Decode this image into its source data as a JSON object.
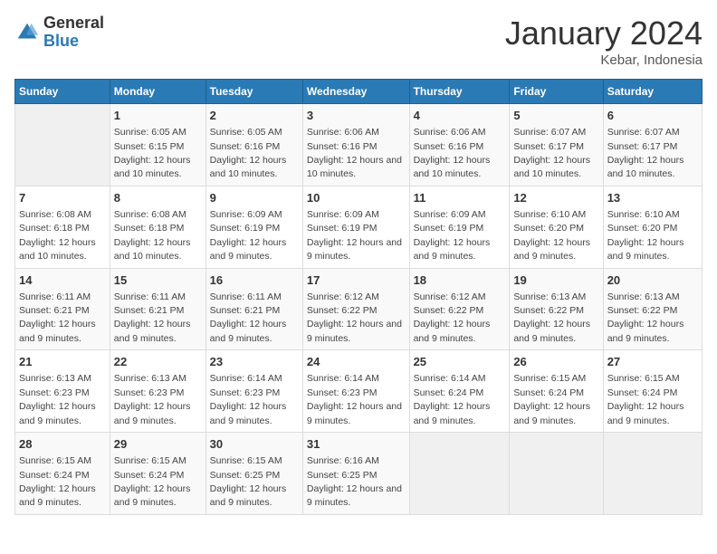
{
  "logo": {
    "general": "General",
    "blue": "Blue"
  },
  "title": "January 2024",
  "location": "Kebar, Indonesia",
  "days_header": [
    "Sunday",
    "Monday",
    "Tuesday",
    "Wednesday",
    "Thursday",
    "Friday",
    "Saturday"
  ],
  "weeks": [
    [
      {
        "num": "",
        "sunrise": "",
        "sunset": "",
        "daylight": ""
      },
      {
        "num": "1",
        "sunrise": "Sunrise: 6:05 AM",
        "sunset": "Sunset: 6:15 PM",
        "daylight": "Daylight: 12 hours and 10 minutes."
      },
      {
        "num": "2",
        "sunrise": "Sunrise: 6:05 AM",
        "sunset": "Sunset: 6:16 PM",
        "daylight": "Daylight: 12 hours and 10 minutes."
      },
      {
        "num": "3",
        "sunrise": "Sunrise: 6:06 AM",
        "sunset": "Sunset: 6:16 PM",
        "daylight": "Daylight: 12 hours and 10 minutes."
      },
      {
        "num": "4",
        "sunrise": "Sunrise: 6:06 AM",
        "sunset": "Sunset: 6:16 PM",
        "daylight": "Daylight: 12 hours and 10 minutes."
      },
      {
        "num": "5",
        "sunrise": "Sunrise: 6:07 AM",
        "sunset": "Sunset: 6:17 PM",
        "daylight": "Daylight: 12 hours and 10 minutes."
      },
      {
        "num": "6",
        "sunrise": "Sunrise: 6:07 AM",
        "sunset": "Sunset: 6:17 PM",
        "daylight": "Daylight: 12 hours and 10 minutes."
      }
    ],
    [
      {
        "num": "7",
        "sunrise": "Sunrise: 6:08 AM",
        "sunset": "Sunset: 6:18 PM",
        "daylight": "Daylight: 12 hours and 10 minutes."
      },
      {
        "num": "8",
        "sunrise": "Sunrise: 6:08 AM",
        "sunset": "Sunset: 6:18 PM",
        "daylight": "Daylight: 12 hours and 10 minutes."
      },
      {
        "num": "9",
        "sunrise": "Sunrise: 6:09 AM",
        "sunset": "Sunset: 6:19 PM",
        "daylight": "Daylight: 12 hours and 9 minutes."
      },
      {
        "num": "10",
        "sunrise": "Sunrise: 6:09 AM",
        "sunset": "Sunset: 6:19 PM",
        "daylight": "Daylight: 12 hours and 9 minutes."
      },
      {
        "num": "11",
        "sunrise": "Sunrise: 6:09 AM",
        "sunset": "Sunset: 6:19 PM",
        "daylight": "Daylight: 12 hours and 9 minutes."
      },
      {
        "num": "12",
        "sunrise": "Sunrise: 6:10 AM",
        "sunset": "Sunset: 6:20 PM",
        "daylight": "Daylight: 12 hours and 9 minutes."
      },
      {
        "num": "13",
        "sunrise": "Sunrise: 6:10 AM",
        "sunset": "Sunset: 6:20 PM",
        "daylight": "Daylight: 12 hours and 9 minutes."
      }
    ],
    [
      {
        "num": "14",
        "sunrise": "Sunrise: 6:11 AM",
        "sunset": "Sunset: 6:21 PM",
        "daylight": "Daylight: 12 hours and 9 minutes."
      },
      {
        "num": "15",
        "sunrise": "Sunrise: 6:11 AM",
        "sunset": "Sunset: 6:21 PM",
        "daylight": "Daylight: 12 hours and 9 minutes."
      },
      {
        "num": "16",
        "sunrise": "Sunrise: 6:11 AM",
        "sunset": "Sunset: 6:21 PM",
        "daylight": "Daylight: 12 hours and 9 minutes."
      },
      {
        "num": "17",
        "sunrise": "Sunrise: 6:12 AM",
        "sunset": "Sunset: 6:22 PM",
        "daylight": "Daylight: 12 hours and 9 minutes."
      },
      {
        "num": "18",
        "sunrise": "Sunrise: 6:12 AM",
        "sunset": "Sunset: 6:22 PM",
        "daylight": "Daylight: 12 hours and 9 minutes."
      },
      {
        "num": "19",
        "sunrise": "Sunrise: 6:13 AM",
        "sunset": "Sunset: 6:22 PM",
        "daylight": "Daylight: 12 hours and 9 minutes."
      },
      {
        "num": "20",
        "sunrise": "Sunrise: 6:13 AM",
        "sunset": "Sunset: 6:22 PM",
        "daylight": "Daylight: 12 hours and 9 minutes."
      }
    ],
    [
      {
        "num": "21",
        "sunrise": "Sunrise: 6:13 AM",
        "sunset": "Sunset: 6:23 PM",
        "daylight": "Daylight: 12 hours and 9 minutes."
      },
      {
        "num": "22",
        "sunrise": "Sunrise: 6:13 AM",
        "sunset": "Sunset: 6:23 PM",
        "daylight": "Daylight: 12 hours and 9 minutes."
      },
      {
        "num": "23",
        "sunrise": "Sunrise: 6:14 AM",
        "sunset": "Sunset: 6:23 PM",
        "daylight": "Daylight: 12 hours and 9 minutes."
      },
      {
        "num": "24",
        "sunrise": "Sunrise: 6:14 AM",
        "sunset": "Sunset: 6:23 PM",
        "daylight": "Daylight: 12 hours and 9 minutes."
      },
      {
        "num": "25",
        "sunrise": "Sunrise: 6:14 AM",
        "sunset": "Sunset: 6:24 PM",
        "daylight": "Daylight: 12 hours and 9 minutes."
      },
      {
        "num": "26",
        "sunrise": "Sunrise: 6:15 AM",
        "sunset": "Sunset: 6:24 PM",
        "daylight": "Daylight: 12 hours and 9 minutes."
      },
      {
        "num": "27",
        "sunrise": "Sunrise: 6:15 AM",
        "sunset": "Sunset: 6:24 PM",
        "daylight": "Daylight: 12 hours and 9 minutes."
      }
    ],
    [
      {
        "num": "28",
        "sunrise": "Sunrise: 6:15 AM",
        "sunset": "Sunset: 6:24 PM",
        "daylight": "Daylight: 12 hours and 9 minutes."
      },
      {
        "num": "29",
        "sunrise": "Sunrise: 6:15 AM",
        "sunset": "Sunset: 6:24 PM",
        "daylight": "Daylight: 12 hours and 9 minutes."
      },
      {
        "num": "30",
        "sunrise": "Sunrise: 6:15 AM",
        "sunset": "Sunset: 6:25 PM",
        "daylight": "Daylight: 12 hours and 9 minutes."
      },
      {
        "num": "31",
        "sunrise": "Sunrise: 6:16 AM",
        "sunset": "Sunset: 6:25 PM",
        "daylight": "Daylight: 12 hours and 9 minutes."
      },
      {
        "num": "",
        "sunrise": "",
        "sunset": "",
        "daylight": ""
      },
      {
        "num": "",
        "sunrise": "",
        "sunset": "",
        "daylight": ""
      },
      {
        "num": "",
        "sunrise": "",
        "sunset": "",
        "daylight": ""
      }
    ]
  ]
}
